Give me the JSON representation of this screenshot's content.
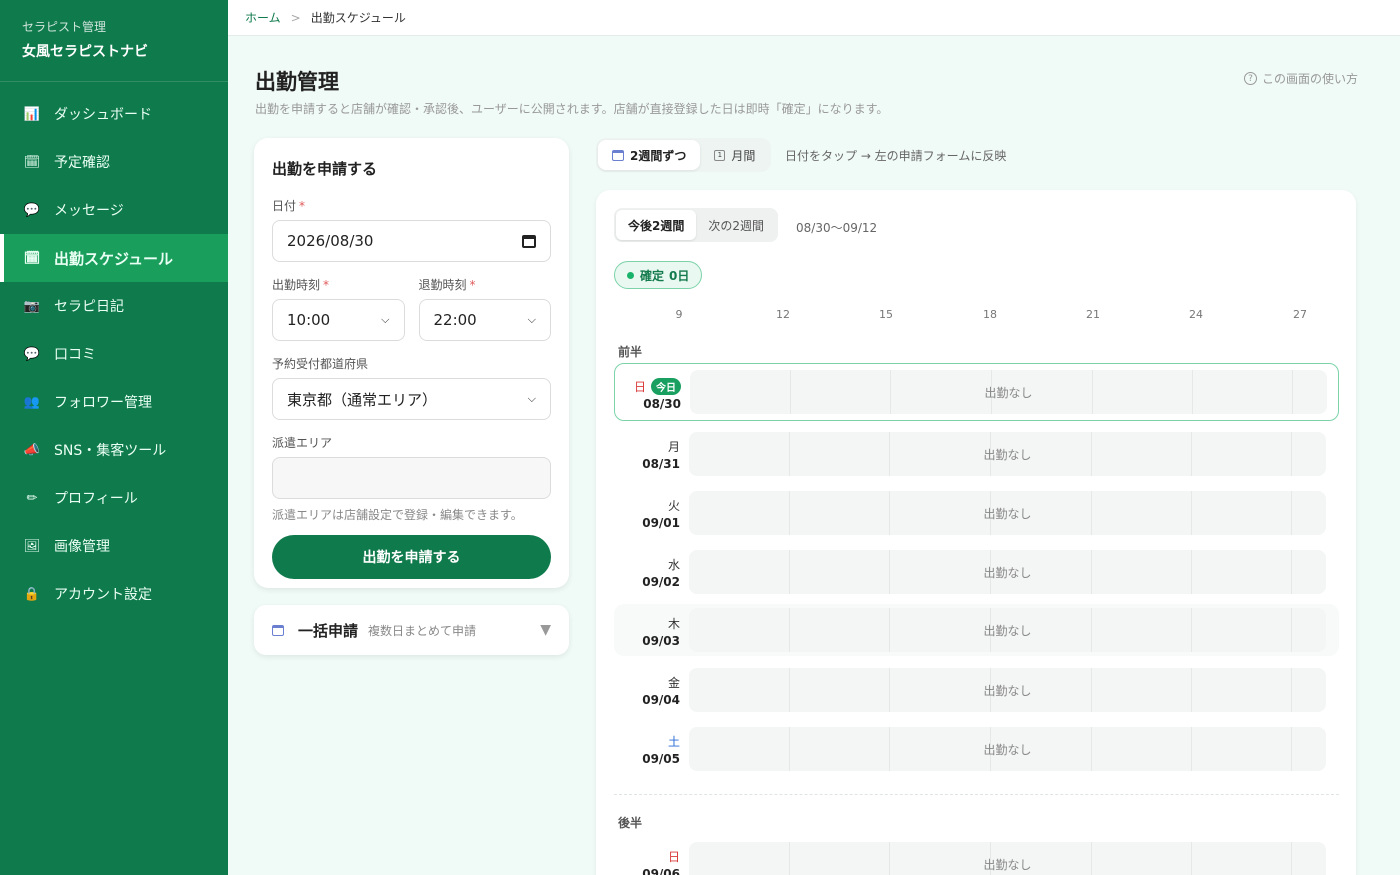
{
  "sidebar": {
    "sub": "セラピスト管理",
    "name": "女風セラピストナビ",
    "items": [
      {
        "label": "ダッシュボード",
        "icon": "📊"
      },
      {
        "label": "予定確認",
        "icon": "🗓"
      },
      {
        "label": "メッセージ",
        "icon": "💬"
      },
      {
        "label": "出勤スケジュール",
        "icon": "🗓"
      },
      {
        "label": "セラピ日記",
        "icon": "📷"
      },
      {
        "label": "口コミ",
        "icon": "💬"
      },
      {
        "label": "フォロワー管理",
        "icon": "👥"
      },
      {
        "label": "SNS・集客ツール",
        "icon": "📣"
      },
      {
        "label": "プロフィール",
        "icon": "✏"
      },
      {
        "label": "画像管理",
        "icon": "🖼"
      },
      {
        "label": "アカウント設定",
        "icon": "🔒"
      }
    ]
  },
  "breadcrumb": {
    "home": "ホーム",
    "sep": ">",
    "current": "出勤スケジュール"
  },
  "header": {
    "title": "出勤管理",
    "desc": "出勤を申請すると店舗が確認・承認後、ユーザーに公開されます。店舗が直接登録した日は即時「確定」になります。",
    "help": "この画面の使い方"
  },
  "form": {
    "title": "出勤を申請する",
    "date_label": "日付",
    "date_value": "2026/08/30",
    "start_label": "出勤時刻",
    "start_value": "10:00",
    "end_label": "退勤時刻",
    "end_value": "22:00",
    "pref_label": "予約受付都道府県",
    "pref_value": "東京都（通常エリア）",
    "area_label": "派遣エリア",
    "area_value": "",
    "area_hint": "派遣エリアは店舗設定で登録・編集できます。",
    "submit": "出勤を申請する",
    "req_mark": "*"
  },
  "bulk": {
    "title": "一括申請",
    "sub": "複数日まとめて申請",
    "arrow": "▼"
  },
  "view": {
    "two_weeks": "2週間ずつ",
    "month": "月間",
    "note": "日付をタップ → 左の申請フォームに反映",
    "one_icon_text": "1"
  },
  "schedule": {
    "tab_next2": "今後2週間",
    "tab_following2": "次の2週間",
    "range": "08/30〜09/12",
    "confirmed_label": "確定",
    "confirmed_count": "0日",
    "axis": [
      "9",
      "12",
      "15",
      "18",
      "21",
      "24",
      "27"
    ],
    "first_half": "前半",
    "second_half": "後半",
    "empty_text": "出勤なし",
    "today_badge": "今日",
    "days": [
      {
        "dow": "日",
        "date": "08/30"
      },
      {
        "dow": "月",
        "date": "08/31"
      },
      {
        "dow": "火",
        "date": "09/01"
      },
      {
        "dow": "水",
        "date": "09/02"
      },
      {
        "dow": "木",
        "date": "09/03"
      },
      {
        "dow": "金",
        "date": "09/04"
      },
      {
        "dow": "土",
        "date": "09/05"
      },
      {
        "dow": "日",
        "date": "09/06"
      }
    ]
  },
  "colors": {
    "brand": "#0f7a4c",
    "active": "#199e5c",
    "saturday": "#2b6dd6",
    "sunday": "#d93a3a"
  }
}
